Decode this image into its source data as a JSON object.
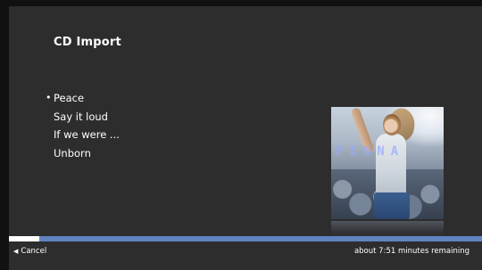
{
  "header": {
    "title": "CD Import"
  },
  "tracks": [
    {
      "name": "Peace",
      "current": true
    },
    {
      "name": "Say it loud",
      "current": false
    },
    {
      "name": "If we were ...",
      "current": false
    },
    {
      "name": "Unborn",
      "current": false
    }
  ],
  "album_art": {
    "artist_text": "FINNA"
  },
  "progress": {
    "fraction": 0.065
  },
  "footer": {
    "cancel_label": "Cancel",
    "cancel_icon": "triangle-left-icon",
    "time_remaining": "about 7:51 minutes remaining"
  },
  "colors": {
    "background": "#2d2d2d",
    "progress_track": "#5f84c0",
    "progress_fill": "#ffffff",
    "text": "#ffffff"
  }
}
